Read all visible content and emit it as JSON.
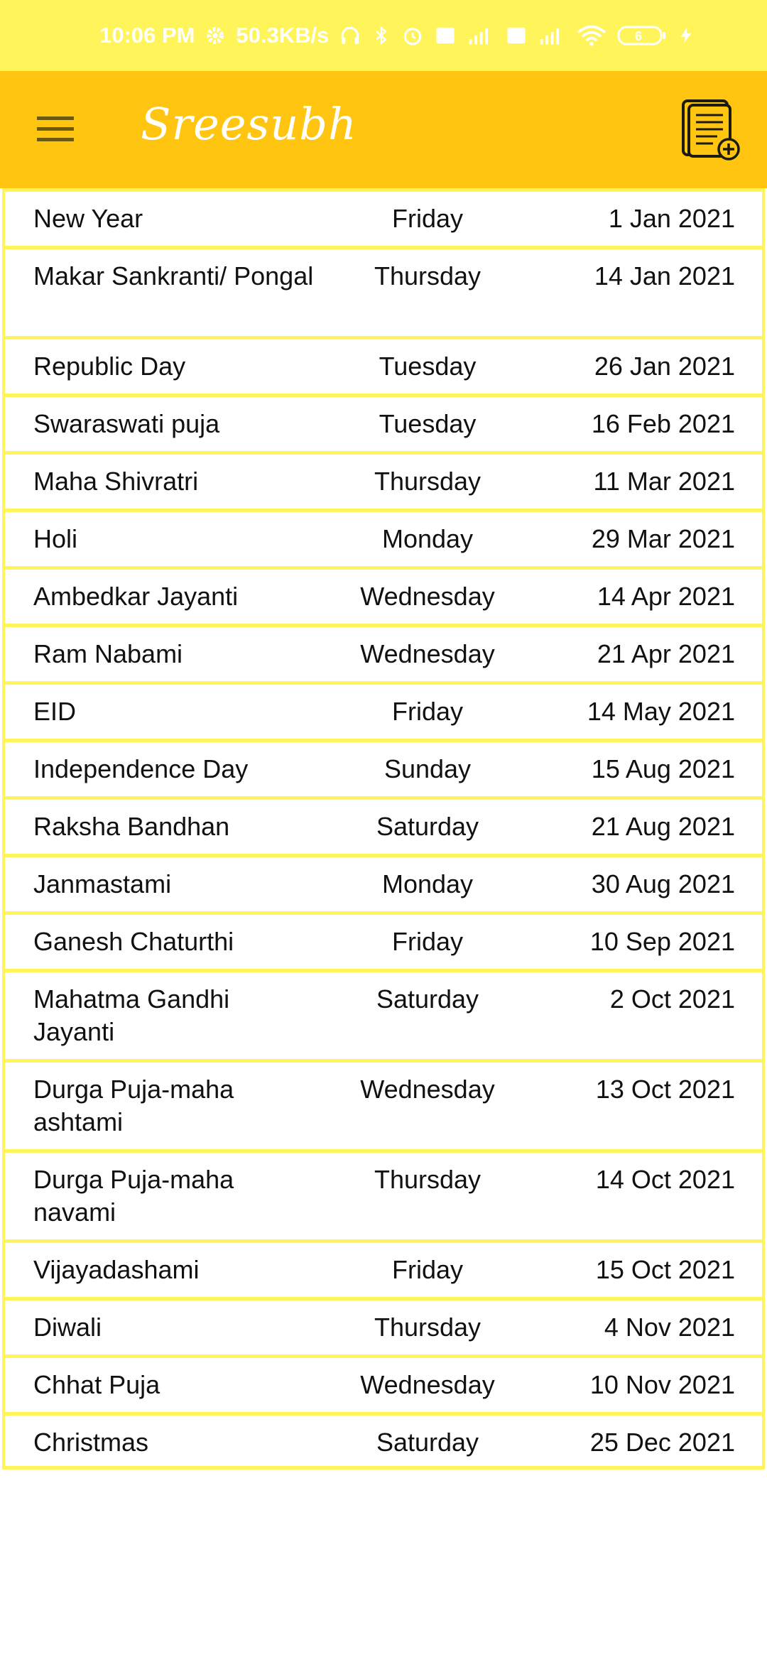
{
  "status_bar": {
    "time": "10:06 PM",
    "speed": "50.3KB/s",
    "battery": "6",
    "icons": [
      "settings-icon",
      "headphones-icon",
      "bluetooth-icon",
      "alarm-icon",
      "volte-icon",
      "signal-icon",
      "volte-icon",
      "signal-icon",
      "wifi-icon",
      "battery-icon",
      "charging-icon"
    ]
  },
  "app_bar": {
    "title": "Sreesubh",
    "menu_icon": "hamburger-menu-icon",
    "action_icon": "document-add-icon"
  },
  "colors": {
    "status_bar": "#fff45a",
    "app_bar": "#ffc510",
    "divider": "#fff45a"
  },
  "holidays": [
    {
      "name": "New Year",
      "day": "Friday",
      "date": "1 Jan 2021"
    },
    {
      "name": "Makar Sankranti/ Pongal",
      "day": "Thursday",
      "date": "14 Jan 2021"
    },
    {
      "name": "Republic Day",
      "day": "Tuesday",
      "date": "26 Jan 2021"
    },
    {
      "name": "Swaraswati puja",
      "day": "Tuesday",
      "date": "16 Feb 2021"
    },
    {
      "name": "Maha Shivratri",
      "day": "Thursday",
      "date": "11 Mar 2021"
    },
    {
      "name": "Holi",
      "day": "Monday",
      "date": "29 Mar 2021"
    },
    {
      "name": "Ambedkar Jayanti",
      "day": "Wednesday",
      "date": "14 Apr 2021"
    },
    {
      "name": "Ram Nabami",
      "day": "Wednesday",
      "date": "21 Apr 2021"
    },
    {
      "name": "EID",
      "day": "Friday",
      "date": "14 May 2021"
    },
    {
      "name": "Independence Day",
      "day": "Sunday",
      "date": "15 Aug 2021"
    },
    {
      "name": "Raksha Bandhan",
      "day": "Saturday",
      "date": "21 Aug 2021"
    },
    {
      "name": "Janmastami",
      "day": "Monday",
      "date": "30 Aug 2021"
    },
    {
      "name": "Ganesh Chaturthi",
      "day": "Friday",
      "date": "10 Sep 2021"
    },
    {
      "name": "Mahatma Gandhi Jayanti",
      "day": "Saturday",
      "date": "2 Oct 2021"
    },
    {
      "name": "Durga Puja-maha ashtami",
      "day": "Wednesday",
      "date": "13 Oct 2021"
    },
    {
      "name": "Durga Puja-maha navami",
      "day": "Thursday",
      "date": "14 Oct 2021"
    },
    {
      "name": "Vijayadashami",
      "day": "Friday",
      "date": "15 Oct 2021"
    },
    {
      "name": "Diwali",
      "day": "Thursday",
      "date": "4 Nov 2021"
    },
    {
      "name": "Chhat Puja",
      "day": "Wednesday",
      "date": "10 Nov 2021"
    },
    {
      "name": "Christmas",
      "day": "Saturday",
      "date": "25 Dec 2021"
    }
  ]
}
